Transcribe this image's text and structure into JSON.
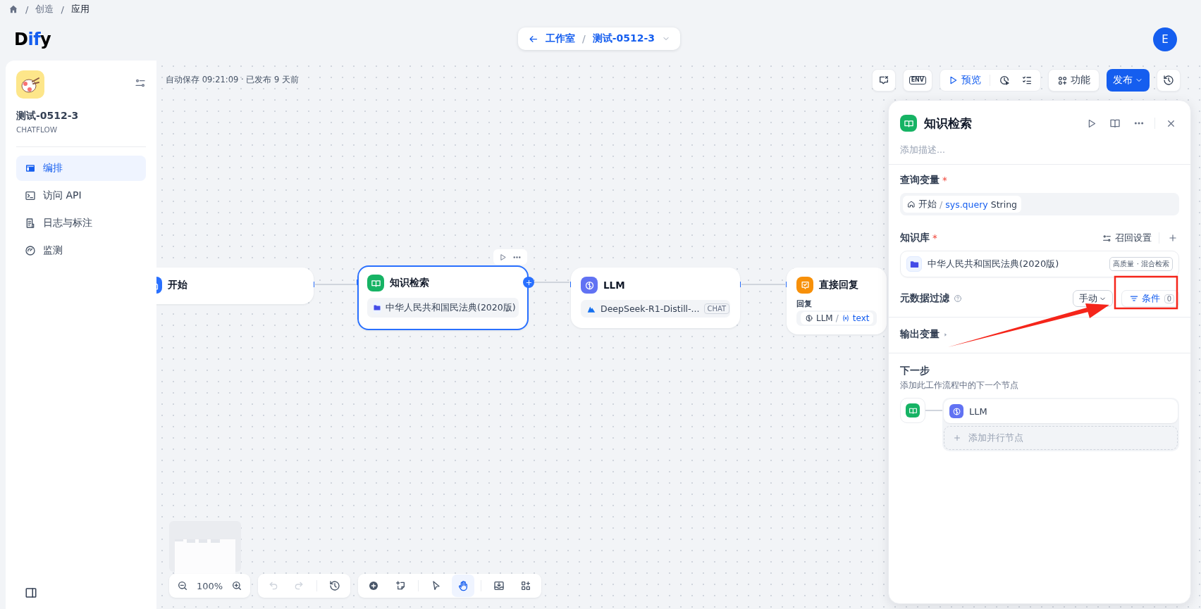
{
  "breadcrumb": {
    "items": [
      {
        "separator": "/",
        "label": "创造"
      },
      {
        "separator": "/",
        "label": "应用"
      }
    ]
  },
  "header": {
    "logo": [
      {
        "text": "D",
        "accent": false
      },
      {
        "text": "if",
        "accent": true
      },
      {
        "text": "y",
        "accent": false
      }
    ],
    "nav_pill": {
      "back": "工作室",
      "separator": "/",
      "app": "测试-0512-3"
    },
    "avatar": "E"
  },
  "sidebar": {
    "app_name": "测试-0512-3",
    "app_type": "CHATFLOW",
    "items": [
      {
        "label": "编排",
        "kind": "layout",
        "selected": true
      },
      {
        "label": "访问 API",
        "kind": "terminal",
        "selected": false
      },
      {
        "label": "日志与标注",
        "kind": "log",
        "selected": false
      },
      {
        "label": "监测",
        "kind": "gauge",
        "selected": false
      }
    ]
  },
  "canvas": {
    "status": "自动保存 09:21:09 · 已发布 9 天前",
    "toolbar": {
      "env": "ENV",
      "preview": "预览",
      "features": "功能",
      "publish": "发布"
    },
    "nodes": [
      {
        "kind": "start",
        "title": "开始",
        "selected": false
      },
      {
        "kind": "knowledge",
        "title": "知识检索",
        "selected": true,
        "dataset": "中华人民共和国民法典(2020版)"
      },
      {
        "kind": "llm",
        "title": "LLM",
        "selected": false,
        "model": "DeepSeek-R1-Distill-...",
        "badge": "CHAT"
      },
      {
        "kind": "answer",
        "title": "直接回复",
        "selected": false,
        "label": "回复",
        "var_node": "LLM",
        "separator": "/",
        "var_name": "text"
      }
    ],
    "zoom": "100%",
    "history_controls": [
      {
        "kind": "undo",
        "disabled": true
      },
      {
        "kind": "redo",
        "disabled": true
      },
      {
        "kind": "history",
        "disabled": false
      }
    ],
    "tools": [
      {
        "kind": "add",
        "selected": false
      },
      {
        "kind": "note",
        "selected": false
      },
      {
        "kind": "pointer",
        "selected": false
      },
      {
        "kind": "hand",
        "selected": true
      },
      {
        "kind": "export",
        "selected": false
      },
      {
        "kind": "layout",
        "selected": false
      }
    ]
  },
  "panel": {
    "title": "知识检索",
    "description": {
      "placeholder": "添加描述..."
    },
    "query": {
      "label": "查询变量",
      "required": "*",
      "node": "开始",
      "separator": "/",
      "variable": "sys.query",
      "type": "String"
    },
    "knowledge": {
      "label": "知识库",
      "required": "*",
      "recall": "召回设置",
      "dataset": "中华人民共和国民法典(2020版)",
      "tag": "高质量 · 混合检索"
    },
    "metadata": {
      "label": "元数据过滤",
      "mode": "手动",
      "condition": "条件",
      "count": "0"
    },
    "output": {
      "label": "输出变量"
    },
    "next": {
      "title": "下一步",
      "description": "添加此工作流程中的下一个节点",
      "node": "LLM",
      "add_parallel": "添加并行节点"
    }
  }
}
